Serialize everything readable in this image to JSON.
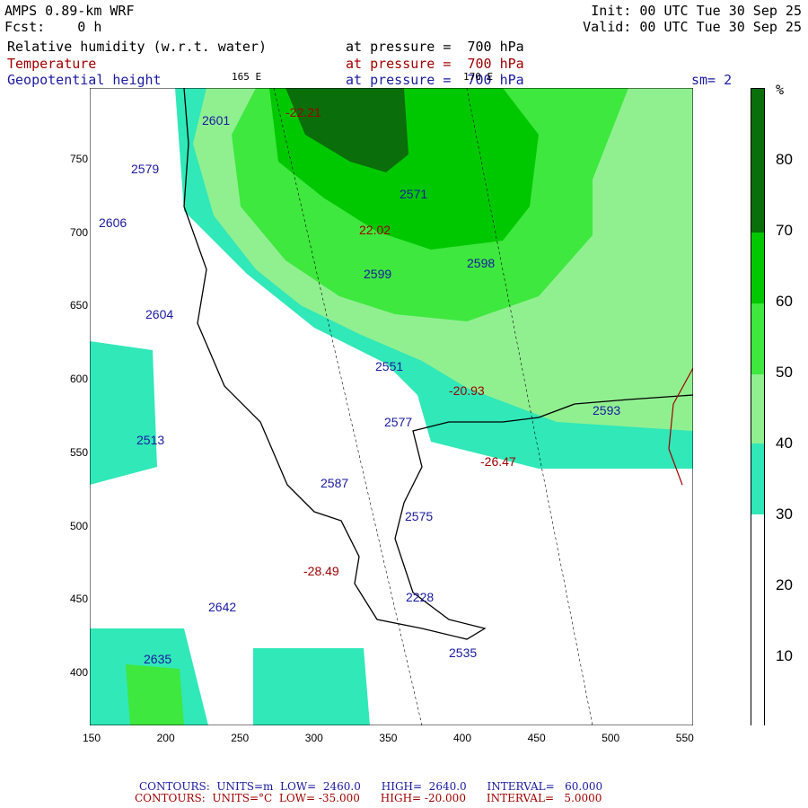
{
  "header": {
    "model": "AMPS 0.89-km WRF",
    "fcst": "Fcst:    0 h",
    "init": "Init: 00 UTC Tue 30 Sep 25",
    "valid": "Valid: 00 UTC Tue 30 Sep 25",
    "field1": "Relative humidity (w.r.t. water)",
    "field1_level": "at pressure =  700 hPa",
    "field2": "Temperature",
    "field2_level": "at pressure =  700 hPa",
    "field3": "Geopotential height",
    "field3_level": "at pressure =  700 hPa",
    "smoothing": "sm= 2",
    "lon1": "165 E",
    "lon2": "170 E"
  },
  "axes": {
    "x_ticks": [
      "150",
      "200",
      "250",
      "300",
      "350",
      "400",
      "450",
      "500",
      "550"
    ],
    "y_ticks": [
      "750",
      "700",
      "650",
      "600",
      "550",
      "500",
      "450",
      "400"
    ]
  },
  "colorbar": {
    "unit": "%",
    "ticks": [
      "80",
      "70",
      "60",
      "50",
      "40",
      "30",
      "20",
      "10"
    ],
    "colors": {
      "c70": "#0a6e0a",
      "c60": "#00c800",
      "c50": "#3ee83e",
      "c40": "#90f090",
      "c30": "#30e8b8",
      "c0": "#ffffff"
    }
  },
  "map_labels": {
    "h2601": "2601",
    "h2571": "2571",
    "t2202": "22.02",
    "h2599": "2599",
    "l2598": "2598",
    "l2604": "2604",
    "l2551": "2551",
    "t2093": "-20.93",
    "h2593": "2593",
    "l2577": "2577",
    "h2587": "2587",
    "t2647": "-26.47",
    "h2579": "2579",
    "h2606": "2606",
    "h2513": "2513",
    "h2635": "2635",
    "h2642": "2642",
    "t2849": "-28.49",
    "l2228": "2228",
    "l2535": "2535",
    "t2221": "-22.21",
    "l2575": "2575"
  },
  "footer": {
    "line1": "CONTOURS:  UNITS=m  LOW=  2460.0      HIGH=  2640.0      INTERVAL=   60.000",
    "line2": "CONTOURS:  UNITS=°C  LOW= -35.000      HIGH= -20.000      INTERVAL=   5.0000"
  }
}
